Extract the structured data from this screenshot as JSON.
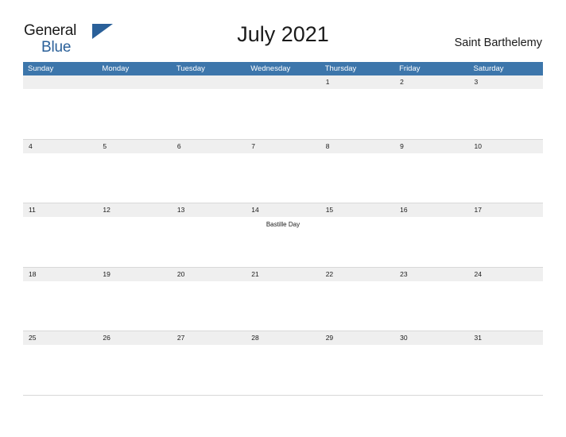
{
  "logo": {
    "word_one": "General",
    "word_two": "Blue",
    "flag_icon": "triangle-flag-icon",
    "flag_color": "#2a6099"
  },
  "header": {
    "title": "July 2021",
    "subtitle": "Saint Barthelemy"
  },
  "colors": {
    "header_row": "#3d76ab",
    "day_band": "#efefef",
    "accent": "#2a6099",
    "text": "#1a1a1a",
    "grid_line": "#d8d8d8"
  },
  "calendar": {
    "day_names": [
      "Sunday",
      "Monday",
      "Tuesday",
      "Wednesday",
      "Thursday",
      "Friday",
      "Saturday"
    ],
    "weeks": [
      [
        {
          "day": "",
          "event": ""
        },
        {
          "day": "",
          "event": ""
        },
        {
          "day": "",
          "event": ""
        },
        {
          "day": "",
          "event": ""
        },
        {
          "day": "1",
          "event": ""
        },
        {
          "day": "2",
          "event": ""
        },
        {
          "day": "3",
          "event": ""
        }
      ],
      [
        {
          "day": "4",
          "event": ""
        },
        {
          "day": "5",
          "event": ""
        },
        {
          "day": "6",
          "event": ""
        },
        {
          "day": "7",
          "event": ""
        },
        {
          "day": "8",
          "event": ""
        },
        {
          "day": "9",
          "event": ""
        },
        {
          "day": "10",
          "event": ""
        }
      ],
      [
        {
          "day": "11",
          "event": ""
        },
        {
          "day": "12",
          "event": ""
        },
        {
          "day": "13",
          "event": ""
        },
        {
          "day": "14",
          "event": "Bastille Day"
        },
        {
          "day": "15",
          "event": ""
        },
        {
          "day": "16",
          "event": ""
        },
        {
          "day": "17",
          "event": ""
        }
      ],
      [
        {
          "day": "18",
          "event": ""
        },
        {
          "day": "19",
          "event": ""
        },
        {
          "day": "20",
          "event": ""
        },
        {
          "day": "21",
          "event": ""
        },
        {
          "day": "22",
          "event": ""
        },
        {
          "day": "23",
          "event": ""
        },
        {
          "day": "24",
          "event": ""
        }
      ],
      [
        {
          "day": "25",
          "event": ""
        },
        {
          "day": "26",
          "event": ""
        },
        {
          "day": "27",
          "event": ""
        },
        {
          "day": "28",
          "event": ""
        },
        {
          "day": "29",
          "event": ""
        },
        {
          "day": "30",
          "event": ""
        },
        {
          "day": "31",
          "event": ""
        }
      ]
    ]
  }
}
